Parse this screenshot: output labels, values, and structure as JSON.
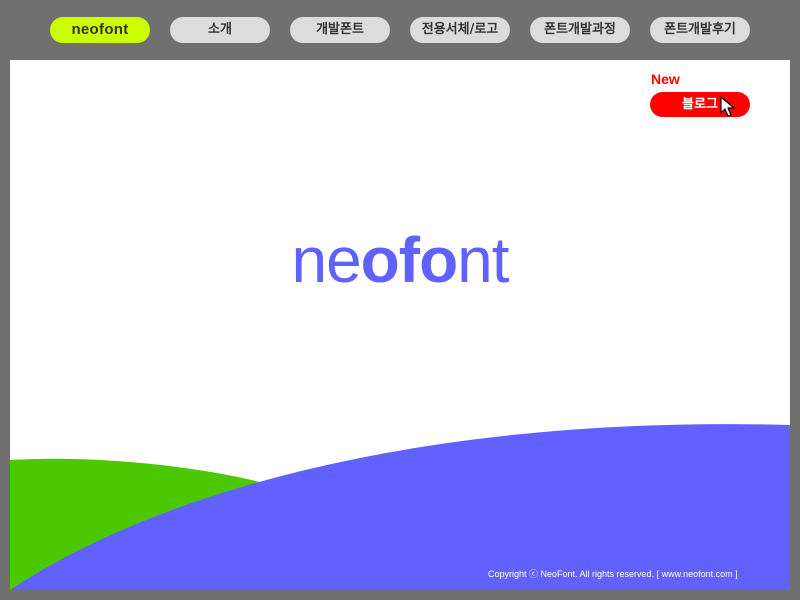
{
  "nav": {
    "items": [
      {
        "label": "neofont",
        "active": true
      },
      {
        "label": "소개"
      },
      {
        "label": "개발폰트"
      },
      {
        "label": "전용서체/로고"
      },
      {
        "label": "폰트개발과정"
      },
      {
        "label": "폰트개발후기"
      }
    ]
  },
  "promo": {
    "new_label": "New",
    "blog_label": "블로그"
  },
  "logo": {
    "part1": "ne",
    "part2": "ofo",
    "part3": "nt"
  },
  "footer": {
    "copyright": "Copyright ⓒ NeoFont. All rights reserved.   [ www.neofont.com ]"
  },
  "colors": {
    "background": "#707070",
    "stage": "#ffffff",
    "brand_pill": "#ccff00",
    "nav_pill": "#dcdcdc",
    "accent_red": "#ff0000",
    "brand_blue": "#6161ff",
    "hill_green": "#4cc800"
  },
  "icons": {
    "cursor": "mouse-pointer-icon"
  }
}
